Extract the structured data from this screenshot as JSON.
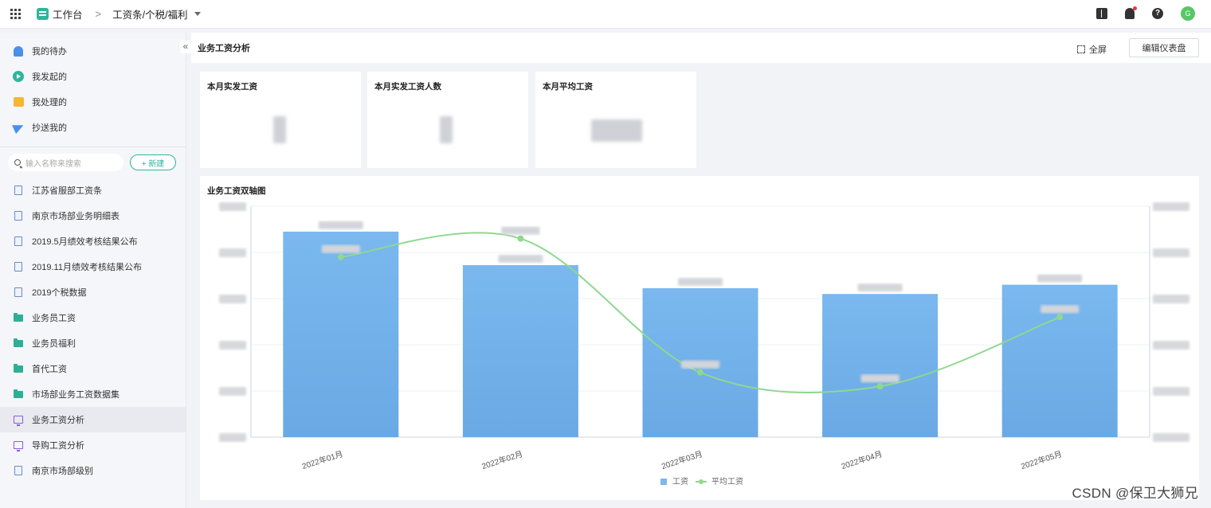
{
  "topbar": {
    "app_name": "工作台",
    "breadcrumb_sep": ">",
    "breadcrumb_current": "工资条/个税/福利",
    "avatar_text": "G"
  },
  "sidebar": {
    "collapse_glyph": "«",
    "quick_items": [
      {
        "label": "我的待办",
        "icon": "bell-icon"
      },
      {
        "label": "我发起的",
        "icon": "play-circle-icon"
      },
      {
        "label": "我处理的",
        "icon": "briefcase-icon"
      },
      {
        "label": "抄送我的",
        "icon": "paper-plane-icon"
      }
    ],
    "search_placeholder": "输入名称来搜索",
    "new_button": "+ 新建",
    "items": [
      {
        "label": "江苏省服部工资条",
        "icon": "doc"
      },
      {
        "label": "南京市场部业务明细表",
        "icon": "doc"
      },
      {
        "label": "2019.5月绩效考核结果公布",
        "icon": "doc"
      },
      {
        "label": "2019.11月绩效考核结果公布",
        "icon": "doc"
      },
      {
        "label": "2019个税数据",
        "icon": "doc"
      },
      {
        "label": "业务员工资",
        "icon": "folder"
      },
      {
        "label": "业务员福利",
        "icon": "folder"
      },
      {
        "label": "首代工资",
        "icon": "folder"
      },
      {
        "label": "市场部业务工资数据集",
        "icon": "folder"
      },
      {
        "label": "业务工资分析",
        "icon": "dashboard",
        "active": true
      },
      {
        "label": "导购工资分析",
        "icon": "dashboard"
      },
      {
        "label": "南京市场部级别",
        "icon": "doc"
      }
    ]
  },
  "main": {
    "title": "业务工资分析",
    "fullscreen_label": "全屏",
    "edit_button": "编辑仪表盘",
    "kpis": [
      {
        "label": "本月实发工资"
      },
      {
        "label": "本月实发工资人数"
      },
      {
        "label": "本月平均工资"
      }
    ],
    "chart_title": "业务工资双轴图"
  },
  "chart_data": {
    "type": "bar",
    "categories": [
      "2022年01月",
      "2022年02月",
      "2022年03月",
      "2022年04月",
      "2022年05月"
    ],
    "series": [
      {
        "name": "工资",
        "type": "bar",
        "axis": "left",
        "values": [
          89,
          74.5,
          64.5,
          62,
          66
        ]
      },
      {
        "name": "平均工资",
        "type": "line",
        "axis": "right",
        "values": [
          78,
          86,
          28,
          22,
          52
        ]
      }
    ],
    "ylim": [
      0,
      100
    ],
    "y2lim": [
      0,
      100
    ],
    "grid": true,
    "legend": "bottom",
    "colors": {
      "bar": "#7ab8ef",
      "bar_bottom": "#6aa9e4",
      "line": "#8fd88f"
    }
  },
  "watermark": "CSDN @保卫大狮兄"
}
